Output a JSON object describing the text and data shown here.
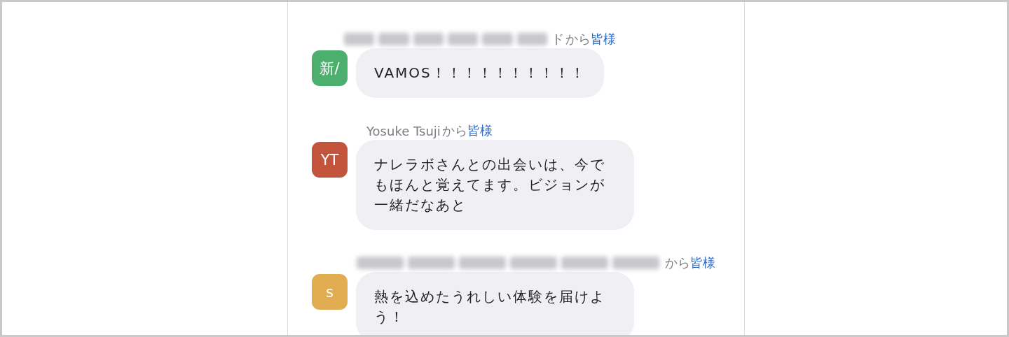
{
  "messages": [
    {
      "sender": {
        "redacted": true,
        "name": "ド",
        "from": "から",
        "to": "皆様"
      },
      "avatar": {
        "initials": "新/",
        "color": "#4caf6e"
      },
      "text": "VAMOS！！！！！！！！！！"
    },
    {
      "sender": {
        "redacted": false,
        "name": "Yosuke Tsuji",
        "from": "から",
        "to": "皆様"
      },
      "avatar": {
        "initials": "YT",
        "color": "#c2543b"
      },
      "text": "ナレラボさんとの出会いは、今でもほんと覚えてます。ビジョンが一緒だなあと"
    },
    {
      "sender": {
        "redacted": true,
        "from": "から",
        "to": "皆様"
      },
      "avatar": {
        "initials": "s",
        "color": "#e1ad50"
      },
      "text": "熱を込めたうれしい体験を届けよう！"
    }
  ]
}
